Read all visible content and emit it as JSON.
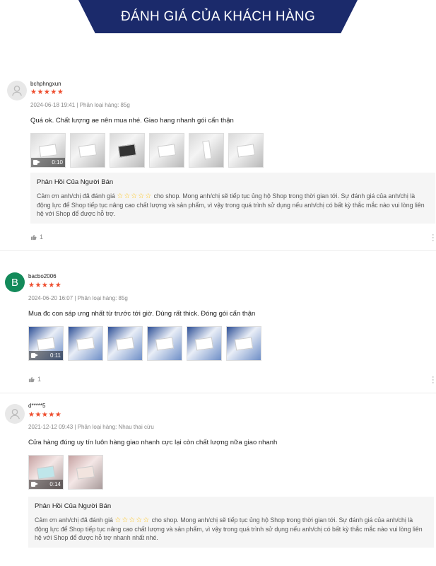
{
  "banner": {
    "title": "ĐÁNH GIÁ CỦA KHÁCH HÀNG"
  },
  "reviews": [
    {
      "username": "bchphngxun",
      "avatar_letter": "",
      "stars": "★★★★★",
      "meta": "2024-06-18 19:41 | Phân loại hàng: 85g",
      "comment": "Quá ok. Chất lượng ae nên mua nhé. Giao hang nhanh gói cẩn thận",
      "video_duration": "0:10",
      "thumb_count": 6,
      "reply": {
        "title": "Phản Hồi Của Người Bán",
        "text_before": "Cảm ơn anh/chị đã đánh giá ",
        "stars": "☆☆☆☆☆",
        "text_after": " cho shop. Mong anh/chị sẽ tiếp tục ủng hộ Shop trong thời gian tới. Sự đánh giá của anh/chị là động lực để Shop tiếp tục nâng cao chất lượng và sản phẩm, vì vậy trong quá trình sử dụng nếu anh/chị có bất kỳ thắc mắc nào vui lòng liên hệ với Shop để được hỗ trợ."
      },
      "likes": "1"
    },
    {
      "username": "bacbo2006",
      "avatar_letter": "B",
      "stars": "★★★★★",
      "meta": "2024-06-20 16:07 | Phân loại hàng: 85g",
      "comment": "Mua đc con sáp ưng nhất từ trước tới giờ. Dùng rất thick. Đóng gói cẩn thận",
      "video_duration": "0:11",
      "thumb_count": 6,
      "likes": "1"
    },
    {
      "username": "d*****5",
      "avatar_letter": "",
      "stars": "★★★★★",
      "meta": "2021-12-12 09:43 | Phân loại hàng: Nhau thai cừu",
      "comment": "Cửa hàng đúng uy tín luôn hàng giao nhanh cực lại còn chất lượng nữa giao nhanh",
      "video_duration": "0:14",
      "thumb_count": 2,
      "reply": {
        "title": "Phản Hồi Của Người Bán",
        "text_before": "Cảm ơn anh/chị đã đánh giá ",
        "stars": "☆☆☆☆☆",
        "text_after": " cho shop. Mong anh/chị sẽ tiếp tục ủng hộ Shop trong thời gian tới. Sự đánh giá của anh/chị là động lực để Shop tiếp tục nâng cao chất lượng và sản phẩm, vì vậy trong quá trình sử dụng nếu anh/chị có bất kỳ thắc mắc nào vui lòng liên hệ với Shop để được hỗ trợ nhanh nhất nhé."
      }
    }
  ],
  "colors": {
    "banner": "#1b2a6b",
    "stars": "#ee4d2d",
    "reply_stars": "#ffbf00",
    "avatar_b": "#138a5a"
  },
  "icons": {
    "video": "camera-icon",
    "like": "thumbs-up-icon",
    "more": "more-vertical-icon",
    "default_avatar": "user-icon"
  }
}
